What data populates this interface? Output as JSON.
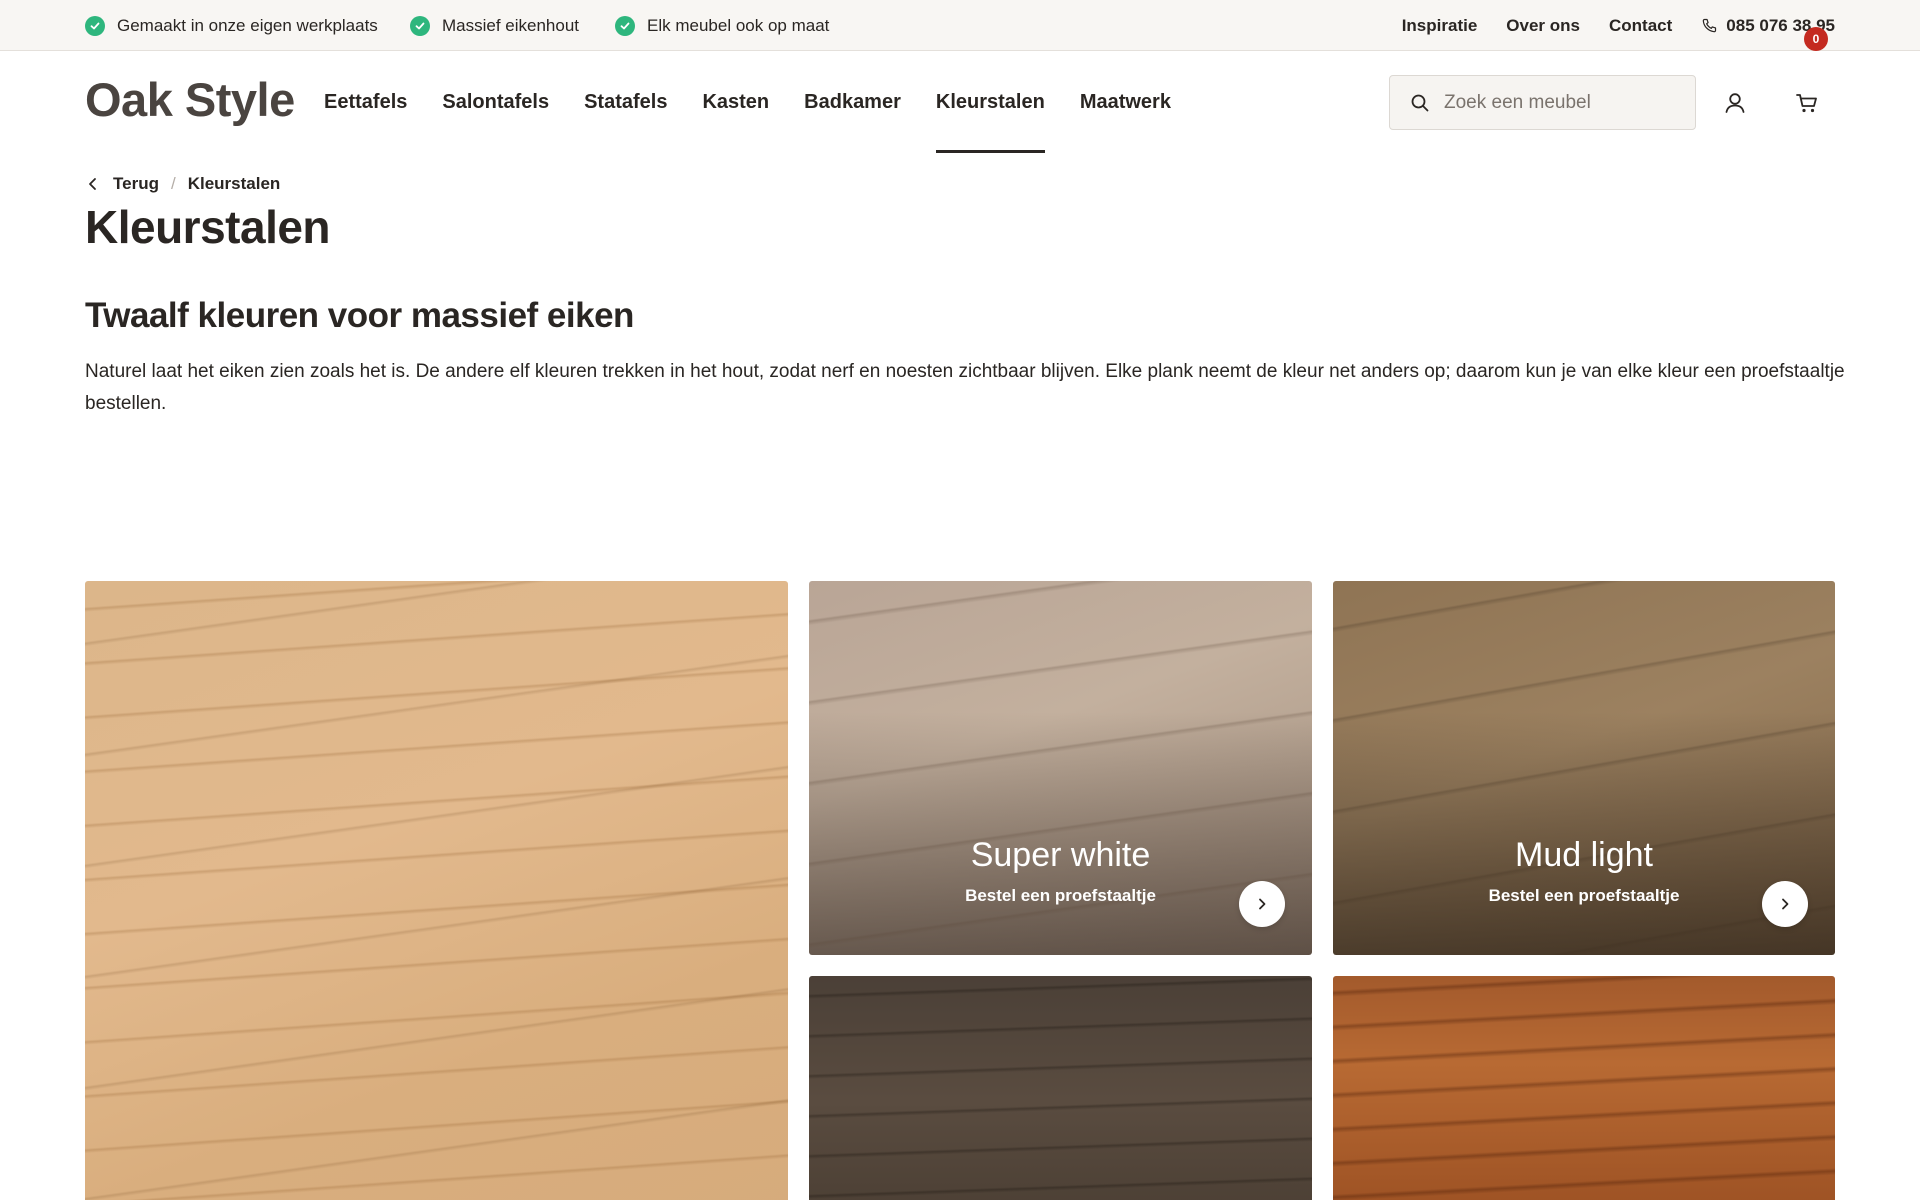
{
  "topbar": {
    "usps": [
      {
        "label": "Gemaakt in onze eigen werkplaats",
        "icon": "check-circle-icon"
      },
      {
        "label": "Massief eikenhout",
        "icon": "check-circle-icon"
      },
      {
        "label": "Elk meubel ook op maat",
        "icon": "check-circle-icon"
      }
    ],
    "links": [
      "Inspiratie",
      "Over ons",
      "Contact"
    ],
    "phone": "085 076 38 95",
    "check_color": "#2eb67d"
  },
  "header": {
    "logo": "Oak Style",
    "nav": [
      {
        "label": "Eettafels",
        "active": false
      },
      {
        "label": "Salontafels",
        "active": false
      },
      {
        "label": "Statafels",
        "active": false
      },
      {
        "label": "Kasten",
        "active": false
      },
      {
        "label": "Badkamer",
        "active": false
      },
      {
        "label": "Kleurstalen",
        "active": true
      },
      {
        "label": "Maatwerk",
        "active": false
      }
    ],
    "search_placeholder": "Zoek een meubel",
    "cart_count": "0",
    "badge_color": "#c42a20"
  },
  "breadcrumb": {
    "back": "Terug",
    "current": "Kleurstalen"
  },
  "page": {
    "title": "Kleurstalen",
    "section_title": "Twaalf kleuren voor massief eiken",
    "intro": "Naturel laat het eiken zien zoals het is. De andere elf kleuren trekken in het hout, zodat nerf en noesten zichtbaar blijven. Elke plank neemt de kleur net anders op; daarom kun je van elke kleur een proefstaaltje bestellen."
  },
  "swatches": [
    {
      "name": "",
      "cta": ""
    },
    {
      "name": "Super white",
      "cta": "Bestel een proefstaaltje"
    },
    {
      "name": "Mud light",
      "cta": "Bestel een proefstaaltje"
    },
    {
      "name": "",
      "cta": ""
    },
    {
      "name": "",
      "cta": ""
    }
  ]
}
